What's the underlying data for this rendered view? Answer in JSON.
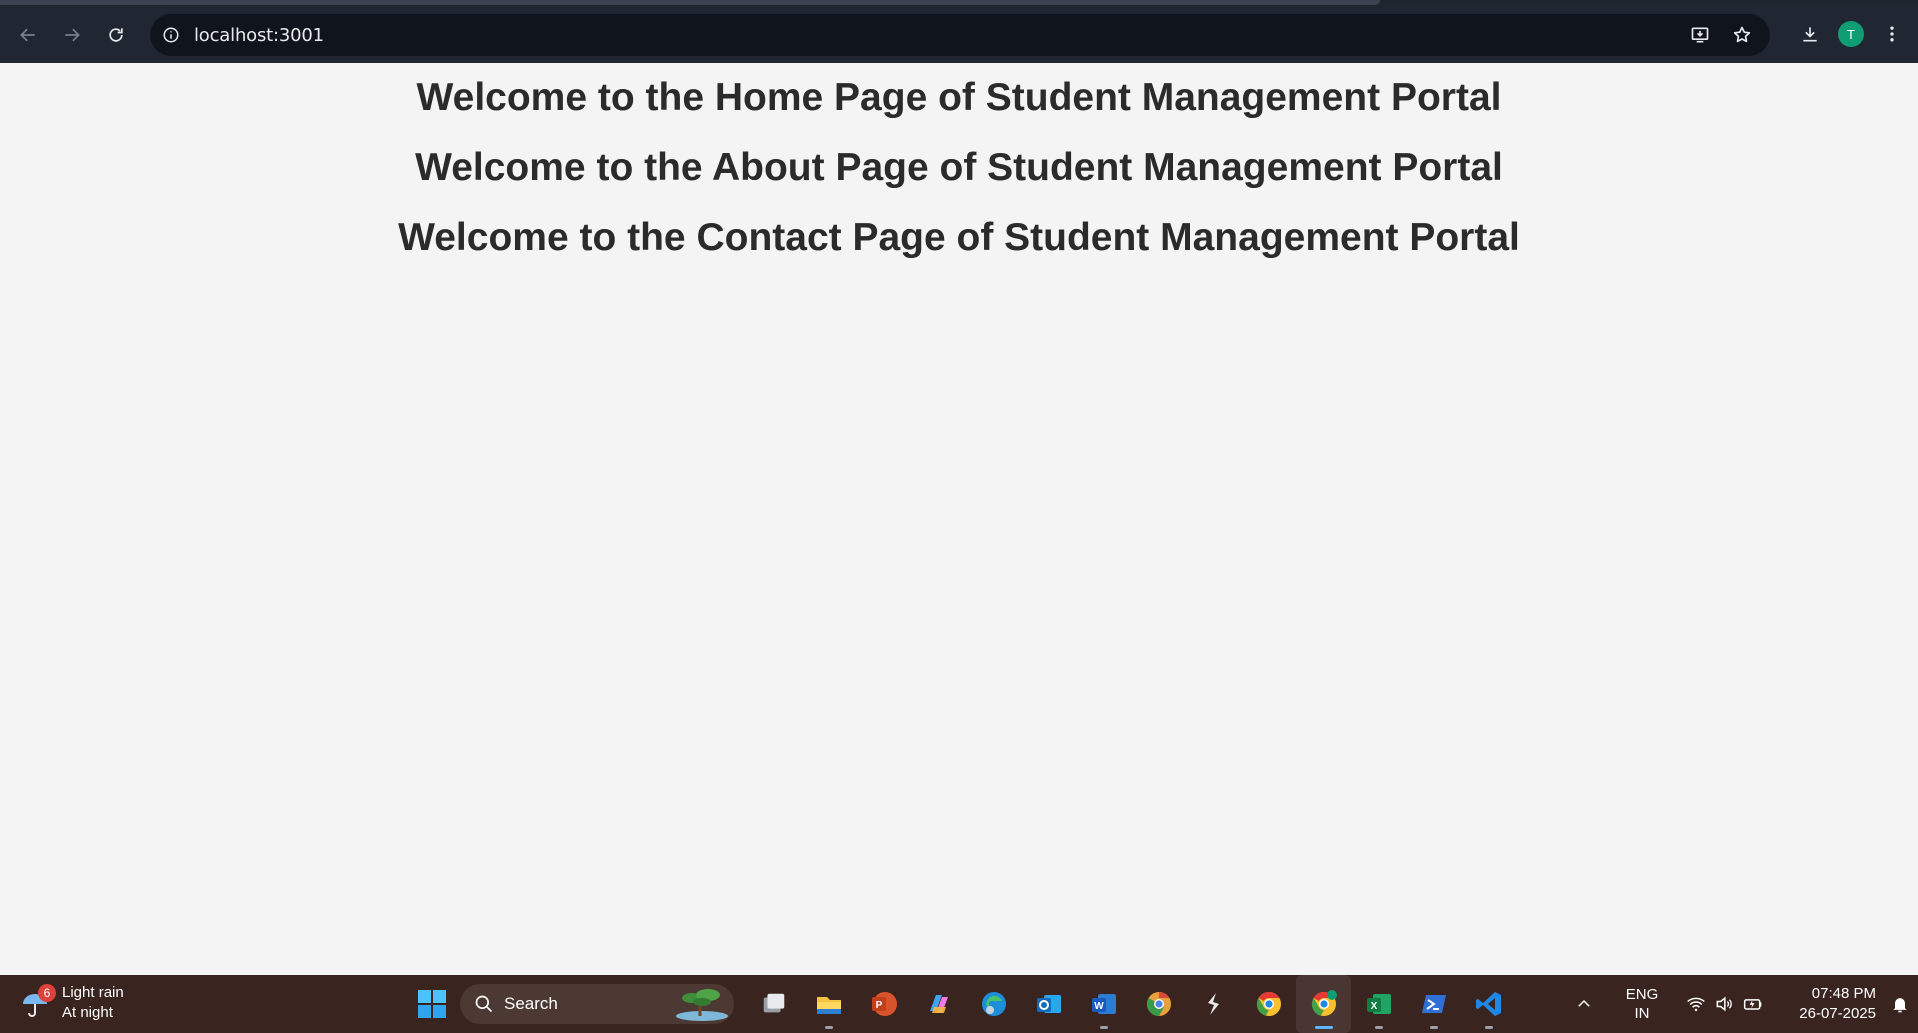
{
  "browser": {
    "url": "localhost:3001",
    "avatar_initial": "T"
  },
  "page": {
    "headings": [
      "Welcome to the Home Page of Student Management Portal",
      "Welcome to the About Page of Student Management Portal",
      "Welcome to the Contact Page of Student Management Portal"
    ]
  },
  "taskbar": {
    "weather": {
      "badge": "6",
      "condition": "Light rain",
      "time_of_day": "At night"
    },
    "search_label": "Search",
    "apps": [
      "task-view-icon",
      "file-explorer-icon",
      "powerpoint-icon",
      "copilot-icon",
      "edge-icon",
      "outlook-icon",
      "word-icon",
      "chrome-canary-icon",
      "sublime-icon",
      "chrome-icon",
      "chrome-profile-icon",
      "excel-icon",
      "powershell-icon",
      "vscode-icon"
    ],
    "language": {
      "line1": "ENG",
      "line2": "IN"
    },
    "clock": {
      "time": "07:48 PM",
      "date": "26-07-2025"
    }
  },
  "colors": {
    "toolbar": "#202732",
    "page_bg": "#f4f4f4",
    "heading": "#2b2b2b",
    "taskbar": "#3a2420",
    "avatar": "#0f9d73"
  }
}
